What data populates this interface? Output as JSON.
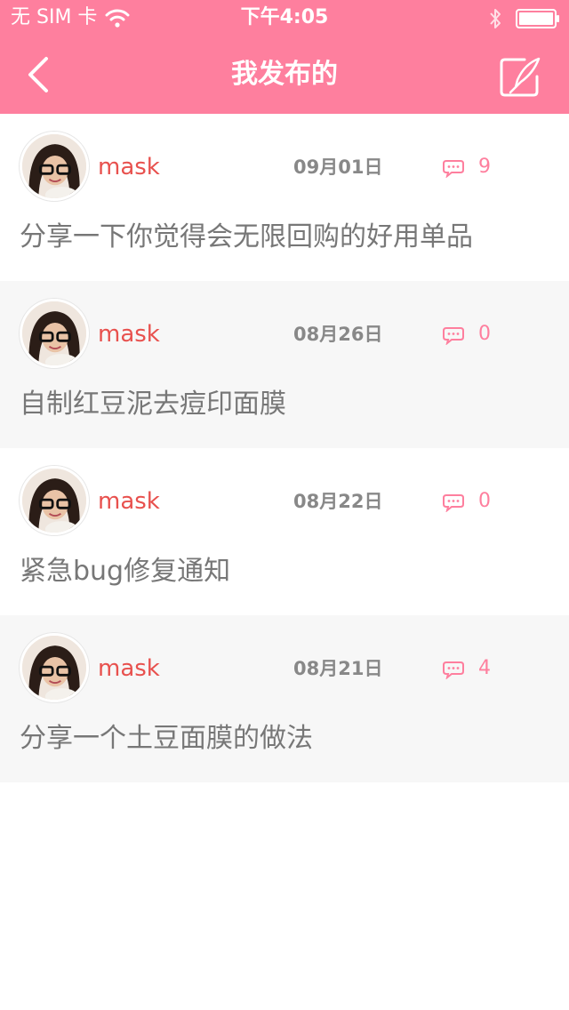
{
  "status_bar": {
    "carrier": "无 SIM 卡",
    "time": "下午4:05"
  },
  "nav": {
    "title": "我发布的"
  },
  "colors": {
    "accent": "#fe7f9e",
    "author": "#e8514e",
    "text": "#777777",
    "date": "#888888",
    "alt_row": "#f7f7f7"
  },
  "posts": [
    {
      "author": "mask",
      "date": "09月01日",
      "comments": "9",
      "title": "分享一下你觉得会无限回购的好用单品"
    },
    {
      "author": "mask",
      "date": "08月26日",
      "comments": "0",
      "title": "自制红豆泥去痘印面膜"
    },
    {
      "author": "mask",
      "date": "08月22日",
      "comments": "0",
      "title": "紧急bug修复通知"
    },
    {
      "author": "mask",
      "date": "08月21日",
      "comments": "4",
      "title": "分享一个土豆面膜的做法"
    }
  ]
}
